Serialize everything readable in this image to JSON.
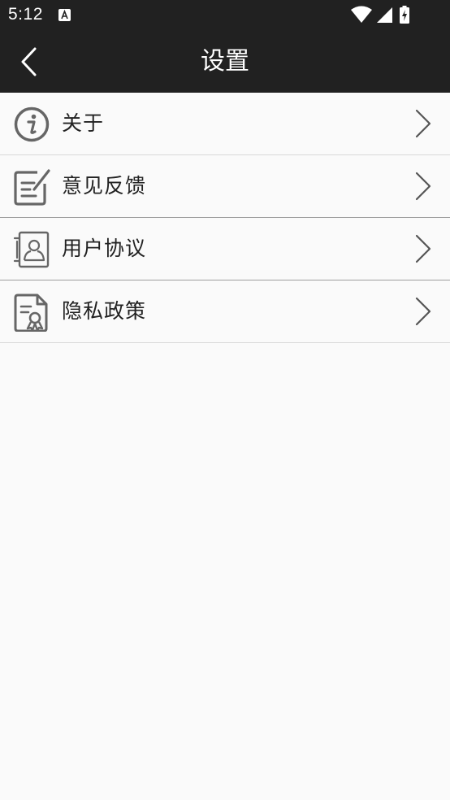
{
  "status_bar": {
    "time": "5:12"
  },
  "header": {
    "title": "设置"
  },
  "settings": {
    "items": [
      {
        "label": "关于",
        "icon": "info-icon"
      },
      {
        "label": "意见反馈",
        "icon": "feedback-edit-icon"
      },
      {
        "label": "用户协议",
        "icon": "user-agreement-icon"
      },
      {
        "label": "隐私政策",
        "icon": "privacy-policy-certificate-icon"
      }
    ]
  },
  "colors": {
    "app_bar": "#212121",
    "background": "#fafafa",
    "icon_gray": "#666666",
    "divider": "#d9d9d9"
  }
}
